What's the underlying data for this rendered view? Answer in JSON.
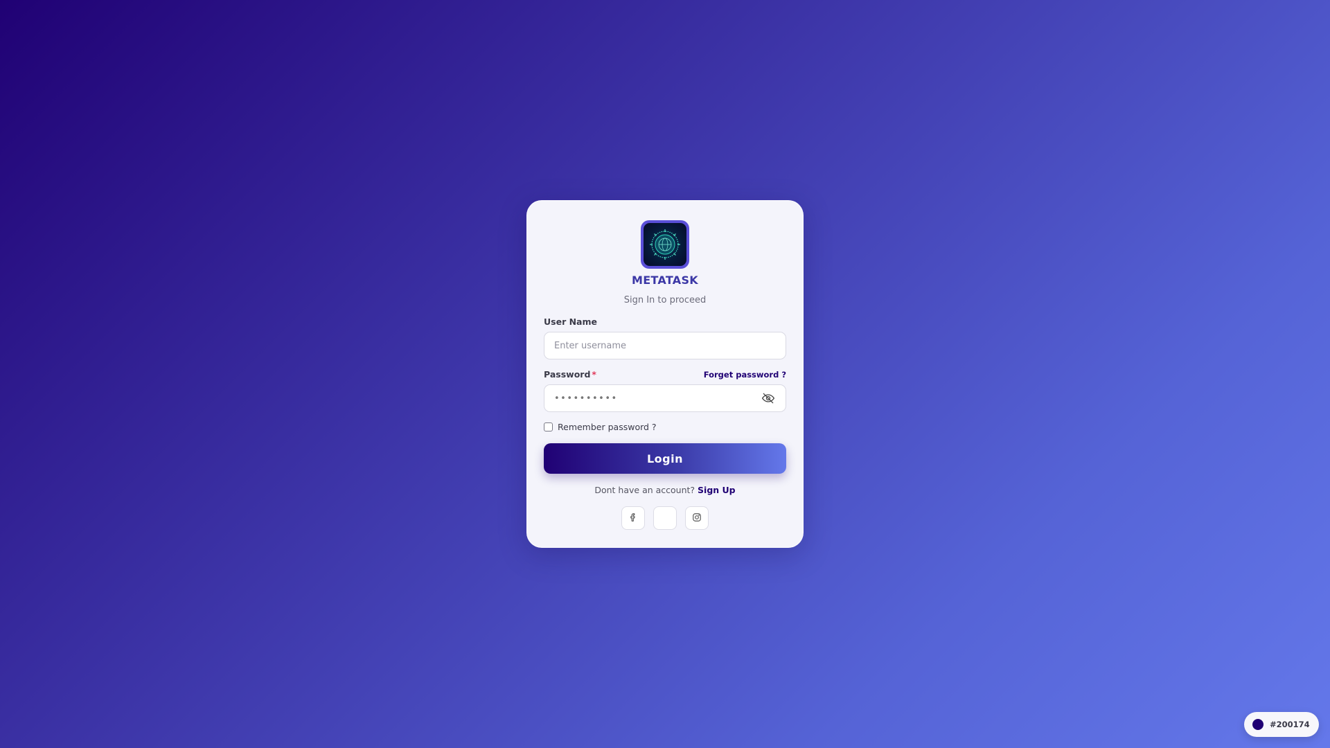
{
  "brand": {
    "name": "METATASK",
    "subtitle": "Sign In to proceed",
    "logo_icon": "virus-globe-icon"
  },
  "form": {
    "username_label": "User Name",
    "username_placeholder": "Enter username",
    "username_value": "",
    "password_label": "Password",
    "password_required_mark": "*",
    "password_value_masked": "••••••••••",
    "forgot_label": "Forget password ?",
    "password_toggle_icon": "eye-slash-icon",
    "remember_label": "Remember password ?",
    "remember_checked": false,
    "login_label": "Login"
  },
  "signup": {
    "prompt": "Dont have an account?",
    "link_label": "Sign Up"
  },
  "social": [
    {
      "icon": "facebook-icon"
    },
    {
      "icon": "blank-social-icon"
    },
    {
      "icon": "instagram-icon"
    }
  ],
  "theme": {
    "primary_color": "#200174",
    "primary_color_label": "#200174",
    "gradient_end": "#6478ea",
    "card_bg": "#f4f4fb"
  }
}
